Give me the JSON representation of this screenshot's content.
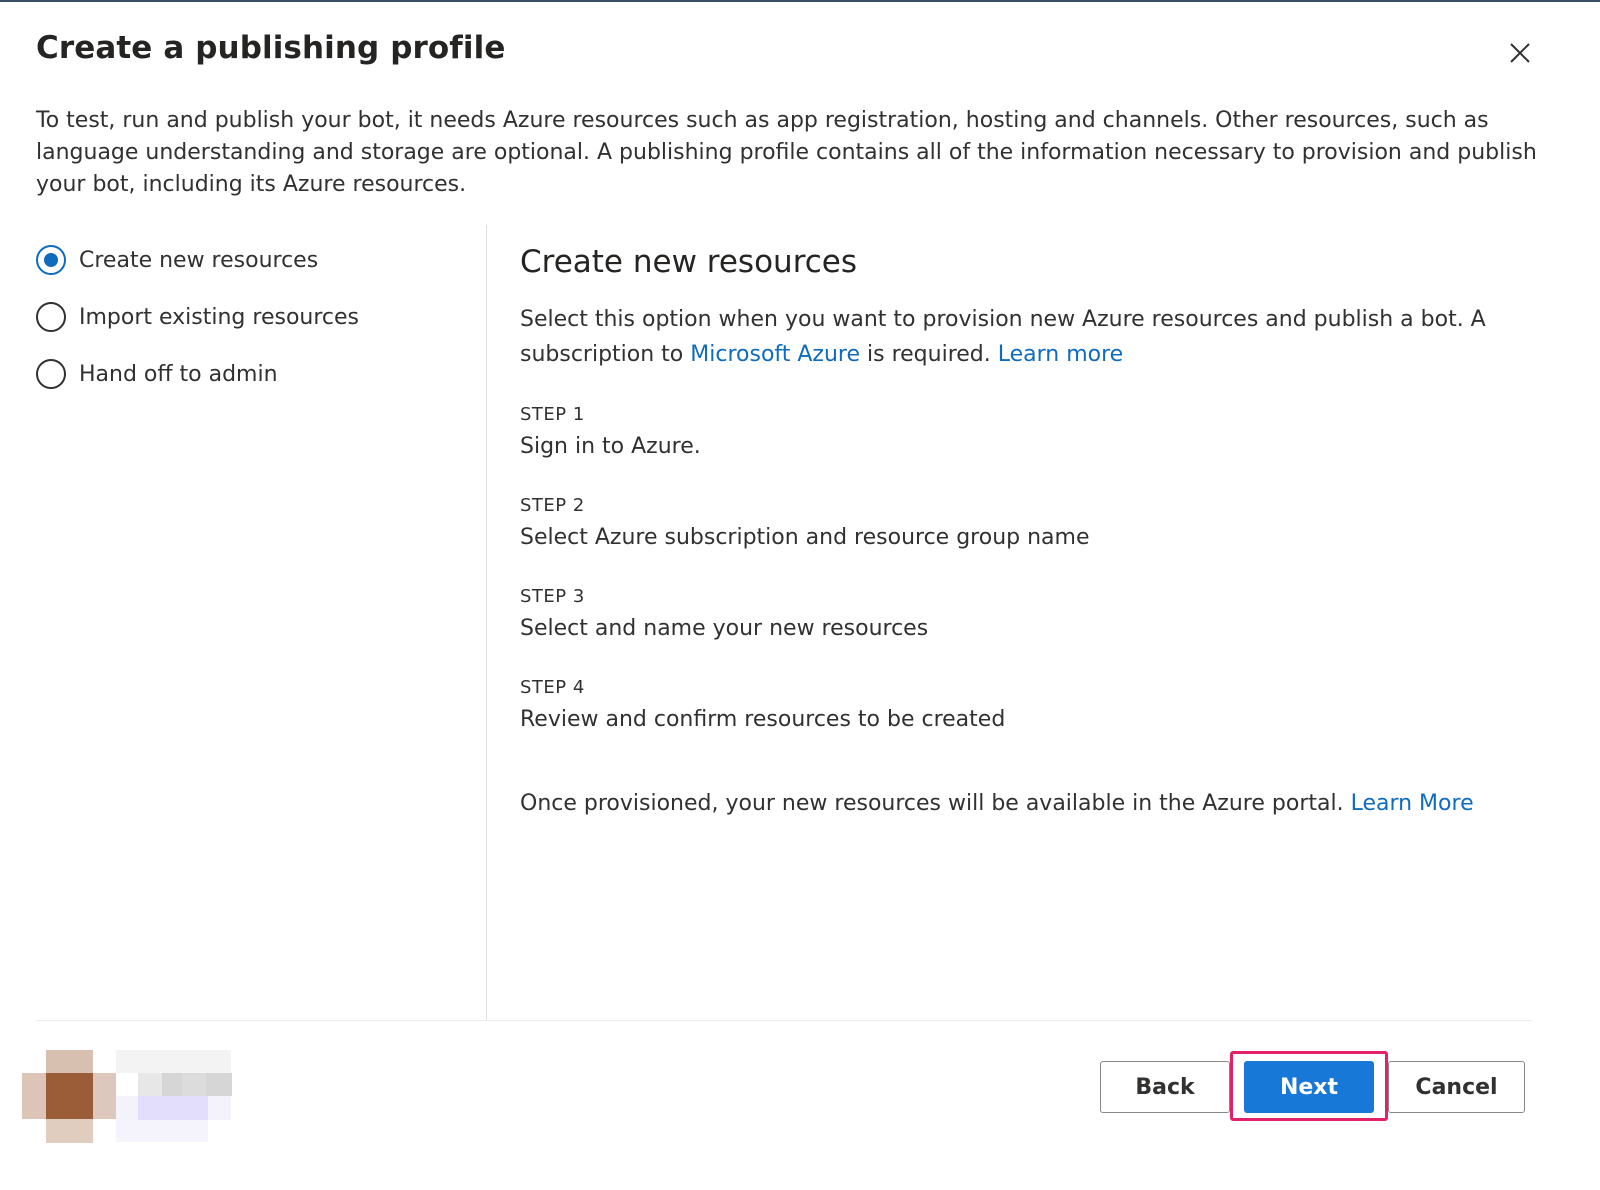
{
  "dialog": {
    "title": "Create a publishing profile",
    "description": "To test, run and publish your bot, it needs Azure resources such as app registration, hosting and channels. Other resources, such as language understanding and storage are optional. A publishing profile contains all of the information necessary to provision and publish your bot, including its Azure resources.",
    "close_icon": "close-icon"
  },
  "options": [
    {
      "label": "Create new resources",
      "checked": true
    },
    {
      "label": "Import existing resources",
      "checked": false
    },
    {
      "label": "Hand off to admin",
      "checked": false
    }
  ],
  "panel": {
    "heading": "Create new resources",
    "intro_before_link": "Select this option when you want to provision new Azure resources and publish a bot. A subscription to ",
    "azure_link": "Microsoft Azure",
    "intro_after_link": " is required. ",
    "learn_more_link": "Learn more",
    "steps": [
      {
        "label": "STEP 1",
        "text": "Sign in to Azure."
      },
      {
        "label": "STEP 2",
        "text": "Select Azure subscription and resource group name"
      },
      {
        "label": "STEP 3",
        "text": "Select and name your new resources"
      },
      {
        "label": "STEP 4",
        "text": "Review and confirm resources to be created"
      }
    ],
    "footer_text": "Once provisioned, your new resources will be available in the Azure portal. ",
    "footer_link": "Learn More"
  },
  "buttons": {
    "back": "Back",
    "next": "Next",
    "cancel": "Cancel"
  },
  "colors": {
    "accent": "#0f6cbd",
    "primary_button": "#1878d8",
    "highlight": "#e4206a"
  }
}
